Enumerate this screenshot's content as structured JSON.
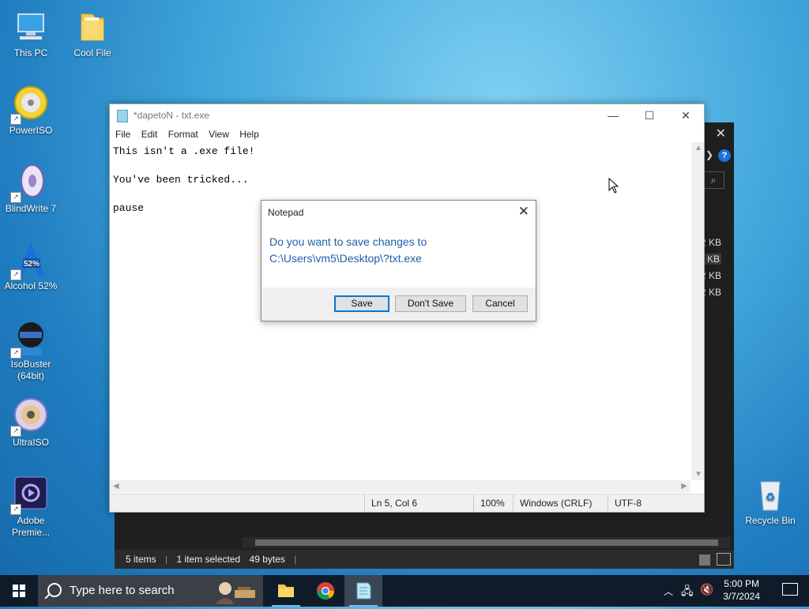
{
  "desktop": {
    "icons": [
      {
        "label": "This PC"
      },
      {
        "label": "Cool File"
      },
      {
        "label": "PowerISO"
      },
      {
        "label": "BlindWrite 7"
      },
      {
        "label": "Alcohol 52%"
      },
      {
        "label": "IsoBuster (64bit)"
      },
      {
        "label": "UltraISO"
      },
      {
        "label": "Adobe Premie..."
      },
      {
        "label": "Recycle Bin"
      }
    ]
  },
  "explorer": {
    "sizes": [
      "2 KB",
      "1 KB",
      "2 KB",
      "2 KB"
    ],
    "status": {
      "items": "5 items",
      "selected": "1 item selected",
      "bytes": "49 bytes"
    }
  },
  "notepad": {
    "title": "*dapetoN - txt.exe",
    "menu": [
      "File",
      "Edit",
      "Format",
      "View",
      "Help"
    ],
    "content": "This isn't a .exe file!\n\nYou've been tricked...\n\npause",
    "status": {
      "position": "Ln 5, Col 6",
      "zoom": "100%",
      "line_ending": "Windows (CRLF)",
      "encoding": "UTF-8"
    }
  },
  "dialog": {
    "title": "Notepad",
    "message_line1": "Do you want to save changes to",
    "message_line2": "C:\\Users\\vm5\\Desktop\\?txt.exe",
    "buttons": {
      "save": "Save",
      "dont_save": "Don't Save",
      "cancel": "Cancel"
    }
  },
  "taskbar": {
    "search_placeholder": "Type here to search",
    "time": "5:00 PM",
    "date": "3/7/2024"
  }
}
